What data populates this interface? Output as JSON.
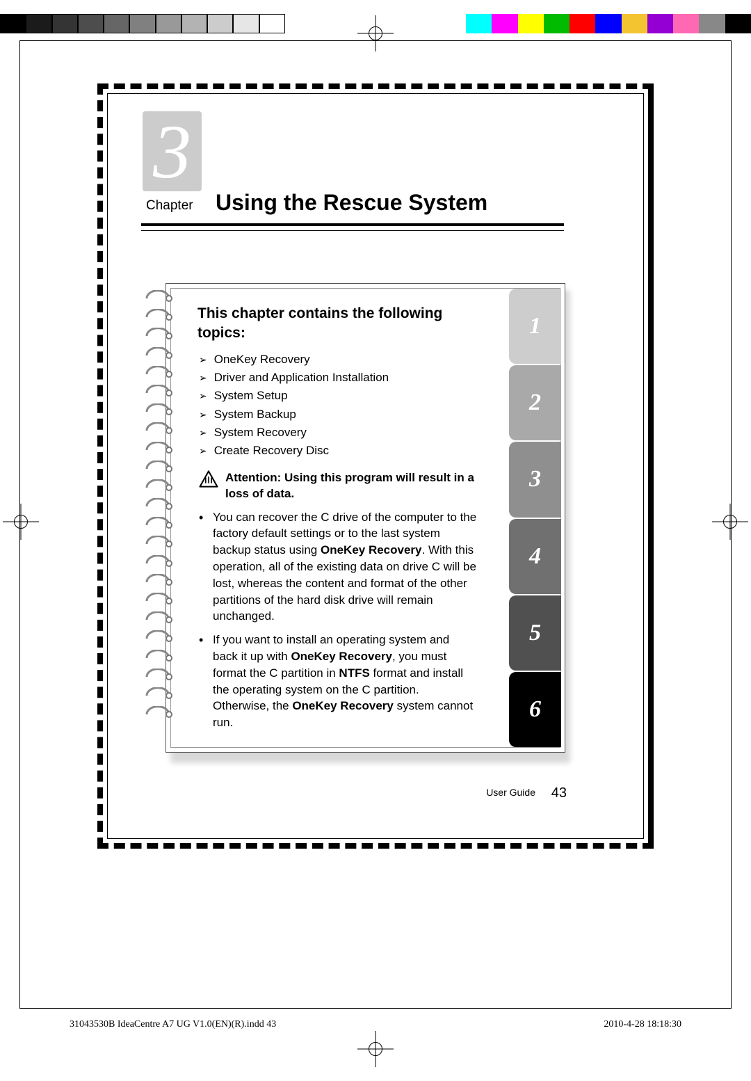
{
  "chapter": {
    "number": "3",
    "label": "Chapter",
    "title": "Using the Rescue System"
  },
  "section_heading": "This chapter contains the following topics:",
  "topics": [
    "OneKey Recovery",
    "Driver and Application Installation",
    "System Setup",
    "System Backup",
    "System Recovery",
    "Create Recovery Disc"
  ],
  "attention": "Attention: Using this program will result in a loss of data.",
  "bullets": [
    "You can recover the C drive of the computer to the factory default settings or to the last system backup status using <b>OneKey Recovery</b>. With this operation, all of the existing data on drive C will be lost, whereas the content and format of the other partitions of the hard disk drive will remain unchanged.",
    "If you want to install an operating system and back it up with <b>OneKey Recovery</b>, you must format the C partition in <b>NTFS</b> format and install the operating system on the C partition. Otherwise, the <b>OneKey Recovery</b> system cannot run."
  ],
  "tabs": [
    {
      "label": "1",
      "bg": "#cdcdcd"
    },
    {
      "label": "2",
      "bg": "#a9a9a9"
    },
    {
      "label": "3",
      "bg": "#8f8f8f"
    },
    {
      "label": "4",
      "bg": "#707070"
    },
    {
      "label": "5",
      "bg": "#505050"
    },
    {
      "label": "6",
      "bg": "#000000"
    }
  ],
  "footer": {
    "label": "User Guide",
    "page": "43"
  },
  "slug": {
    "left": "31043530B IdeaCentre A7 UG V1.0(EN)(R).indd   43",
    "right": "2010-4-28   18:18:30"
  },
  "colorbar_gray": [
    "#000",
    "#1b1b1b",
    "#343434",
    "#4d4d4d",
    "#666",
    "#808080",
    "#999",
    "#b3b3b3",
    "#ccc",
    "#e6e6e6",
    "#fff"
  ],
  "colorbar_colors": [
    "#0ff",
    "#f0f",
    "#ff0",
    "#0b0",
    "#f00",
    "#00f",
    "#f4c430",
    "#9400d3",
    "#ff69b4",
    "#888",
    "#000"
  ]
}
